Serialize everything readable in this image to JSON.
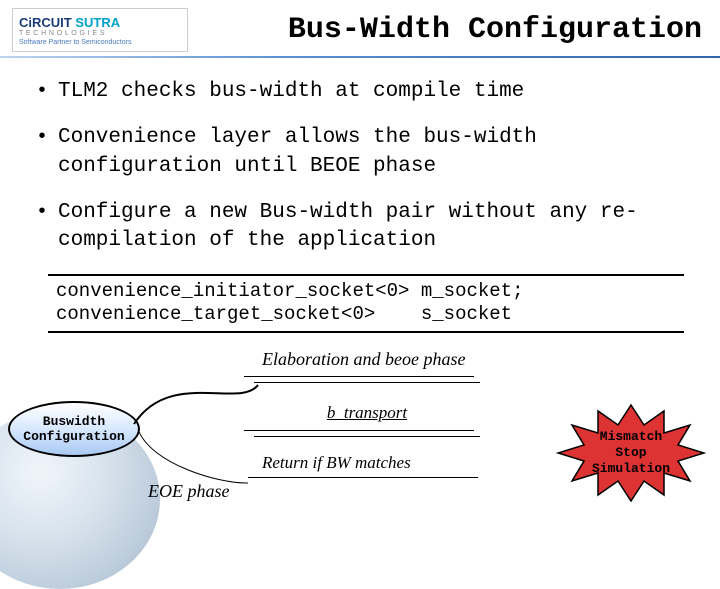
{
  "logo": {
    "brand_prefix": "Ci",
    "brand_mid": "RCUIT",
    "brand_suffix": "SUTRA",
    "subline": "T E C H N O L O G I E S",
    "tagline": "Software Partner to Semiconductors"
  },
  "title": "Bus-Width Configuration",
  "bullets": [
    "TLM2 checks bus-width at compile time",
    "Convenience layer allows the bus-width configuration until BEOE phase",
    "Configure a new Bus-width pair without any re-compilation of the application"
  ],
  "code": {
    "line1": "convenience_initiator_socket<0> m_socket;",
    "line2": "convenience_target_socket<0>    s_socket"
  },
  "diagram": {
    "buswidth_label": "Buswidth\nConfiguration",
    "eoe_label": "EOE phase",
    "elab_label": "Elaboration and beoe phase",
    "btransport_label": "b_transport",
    "return_label": "Return if BW matches",
    "star_text": "Mismatch\nStop\nSimulation"
  }
}
